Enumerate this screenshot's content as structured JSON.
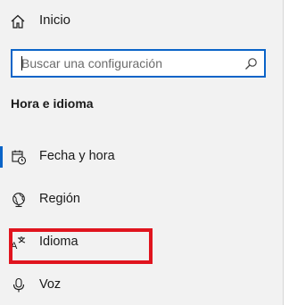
{
  "home": {
    "label": "Inicio",
    "icon": "home-icon"
  },
  "search": {
    "placeholder": "Buscar una configuración",
    "value": "",
    "icon": "search-icon"
  },
  "section": {
    "title": "Hora e idioma"
  },
  "nav": {
    "items": [
      {
        "label": "Fecha y hora",
        "icon": "calendar-clock-icon",
        "selected": false
      },
      {
        "label": "Región",
        "icon": "globe-region-icon",
        "selected": false
      },
      {
        "label": "Idioma",
        "icon": "language-icon",
        "selected": true
      },
      {
        "label": "Voz",
        "icon": "microphone-icon",
        "selected": false
      }
    ]
  },
  "colors": {
    "accent": "#0a64c8",
    "highlight_box": "#e0141e",
    "sidebar_bg": "#f2f2f2"
  }
}
